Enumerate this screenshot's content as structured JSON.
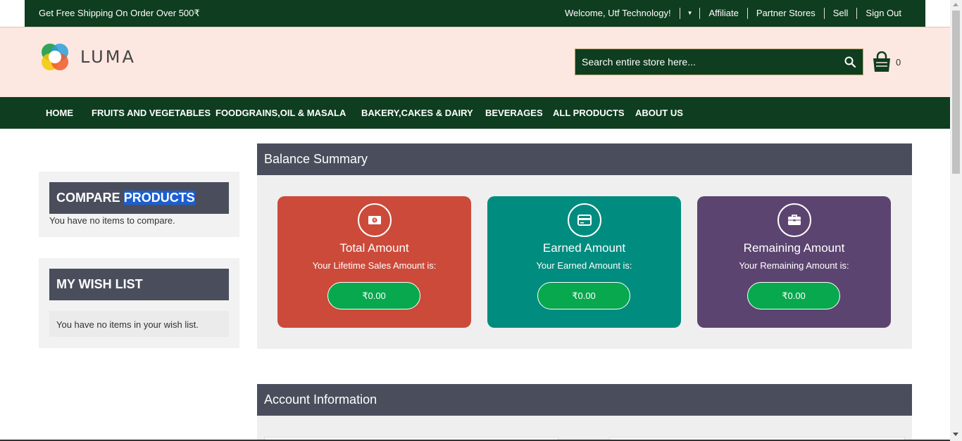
{
  "topbar": {
    "shipping": "Get Free Shipping On Order Over 500₹",
    "welcome": "Welcome, Utf Technology!",
    "caret": "▼",
    "links": [
      "Affiliate",
      "Partner Stores",
      "Sell",
      "Sign Out"
    ]
  },
  "header": {
    "logo_text": "LUMA",
    "search_placeholder": "Search entire store here...",
    "cart_count": "0"
  },
  "nav": [
    "HOME",
    "FRUITS AND VEGETABLES",
    "FOODGRAINS,OIL & MASALA",
    "BAKERY,CAKES & DAIRY",
    "BEVERAGES",
    "ALL PRODUCTS",
    "ABOUT US"
  ],
  "sidebar": {
    "compare_title_a": "COMPARE",
    "compare_title_b": "PRODUCTS",
    "compare_msg": "You have no items to compare.",
    "wish_title": "MY WISH LIST",
    "wish_msg": "You have no items in your wish list."
  },
  "balance": {
    "heading": "Balance Summary",
    "cards": [
      {
        "title": "Total Amount",
        "subtitle": "Your Lifetime Sales Amount is:",
        "amount": "₹0.00",
        "color": "#cc4a3a",
        "icon": "money-icon"
      },
      {
        "title": "Earned Amount",
        "subtitle": "Your Earned Amount is:",
        "amount": "₹0.00",
        "color": "#008c7f",
        "icon": "credit-card-icon"
      },
      {
        "title": "Remaining Amount",
        "subtitle": "Your Remaining Amount is:",
        "amount": "₹0.00",
        "color": "#5c4470",
        "icon": "briefcase-icon"
      }
    ]
  },
  "account": {
    "heading": "Account Information"
  },
  "colors": {
    "topbar": "#0e3d1f",
    "header_bg": "#fde7e1",
    "panel_head": "#4a4e5c",
    "amount_button": "#08a84e"
  }
}
